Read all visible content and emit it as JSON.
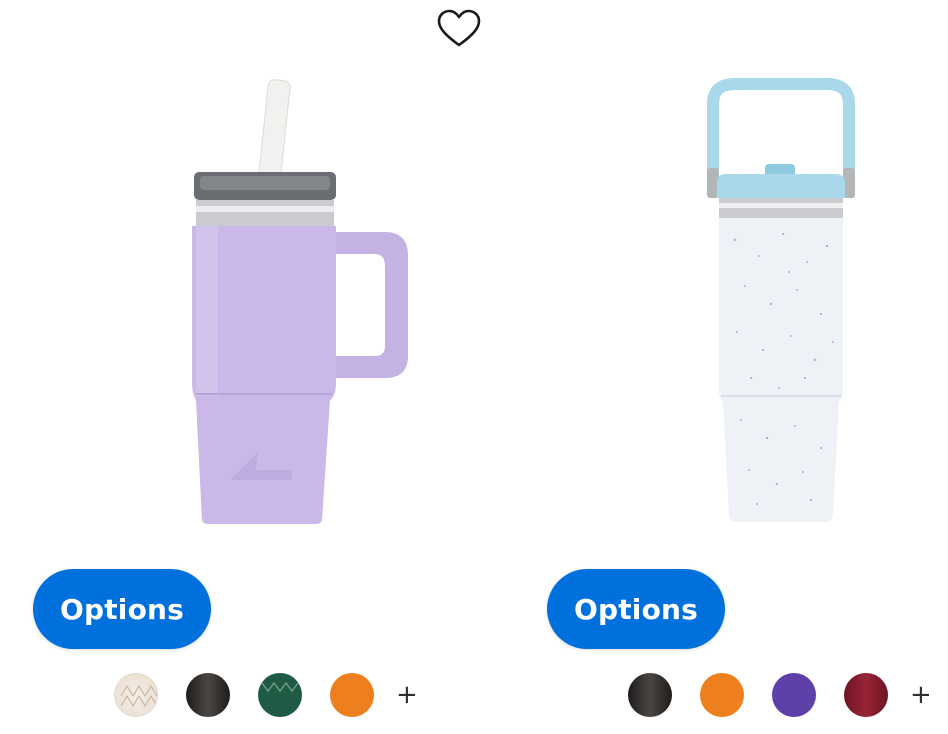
{
  "favorite": {
    "icon": "heart-outline-icon"
  },
  "products": [
    {
      "image": "lavender-tumbler-with-handle-and-straw",
      "body_color": "#c9b8e8",
      "options_label": "Options",
      "swatches": [
        {
          "name": "cream-pattern-swatch",
          "color": "#efe6dc"
        },
        {
          "name": "black-swatch",
          "color": "#2c2a28"
        },
        {
          "name": "green-pattern-swatch",
          "color": "#1f5a45"
        },
        {
          "name": "orange-swatch",
          "color": "#ee7f1e"
        }
      ],
      "more_label": "+"
    },
    {
      "image": "speckled-white-tumbler-with-blue-handle",
      "body_color": "#eef2f7",
      "options_label": "Options",
      "swatches": [
        {
          "name": "black-swatch",
          "color": "#2c2a28"
        },
        {
          "name": "orange-swatch",
          "color": "#ee7f1e"
        },
        {
          "name": "purple-swatch",
          "color": "#5e40a8"
        },
        {
          "name": "maroon-swatch",
          "color": "#8c1d2f"
        }
      ],
      "more_label": "+"
    }
  ],
  "colors": {
    "accent": "#0071dc"
  }
}
